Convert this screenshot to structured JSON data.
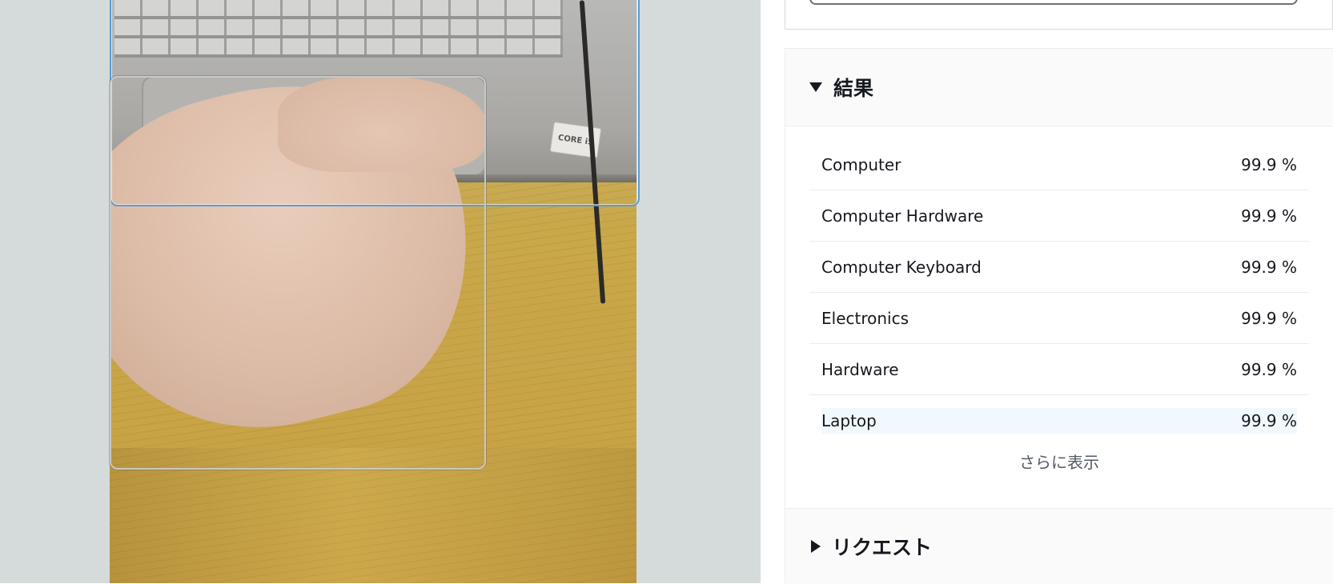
{
  "image": {
    "sticker_text": "CORE i5",
    "detected_boxes": [
      "laptop",
      "hand"
    ]
  },
  "results_section": {
    "title": "結果",
    "items": [
      {
        "label": "Computer",
        "confidence": "99.9 %"
      },
      {
        "label": "Computer Hardware",
        "confidence": "99.9 %"
      },
      {
        "label": "Computer Keyboard",
        "confidence": "99.9 %"
      },
      {
        "label": "Electronics",
        "confidence": "99.9 %"
      },
      {
        "label": "Hardware",
        "confidence": "99.9 %"
      },
      {
        "label": "Laptop",
        "confidence": "99.9 %"
      }
    ],
    "show_more": "さらに表示"
  },
  "request_section": {
    "title": "リクエスト"
  },
  "colors": {
    "stage_bg": "#d5dbdb",
    "laptop_box": "#5b9bd5",
    "hand_box": "#c8c8c8",
    "highlight_row": "#f1f8fe"
  }
}
